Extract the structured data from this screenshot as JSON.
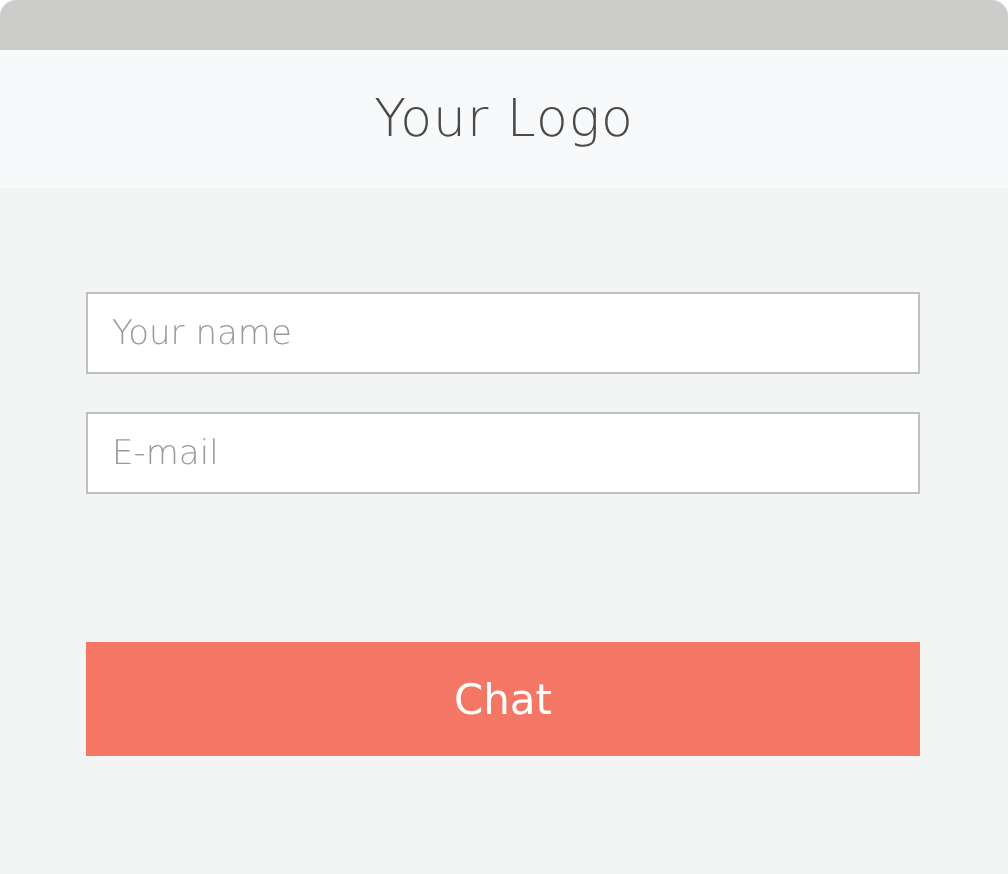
{
  "header": {
    "logo": "Your Logo"
  },
  "form": {
    "fields": [
      {
        "placeholder": "Your name"
      },
      {
        "placeholder": "E-mail"
      }
    ],
    "submit": "Chat"
  }
}
